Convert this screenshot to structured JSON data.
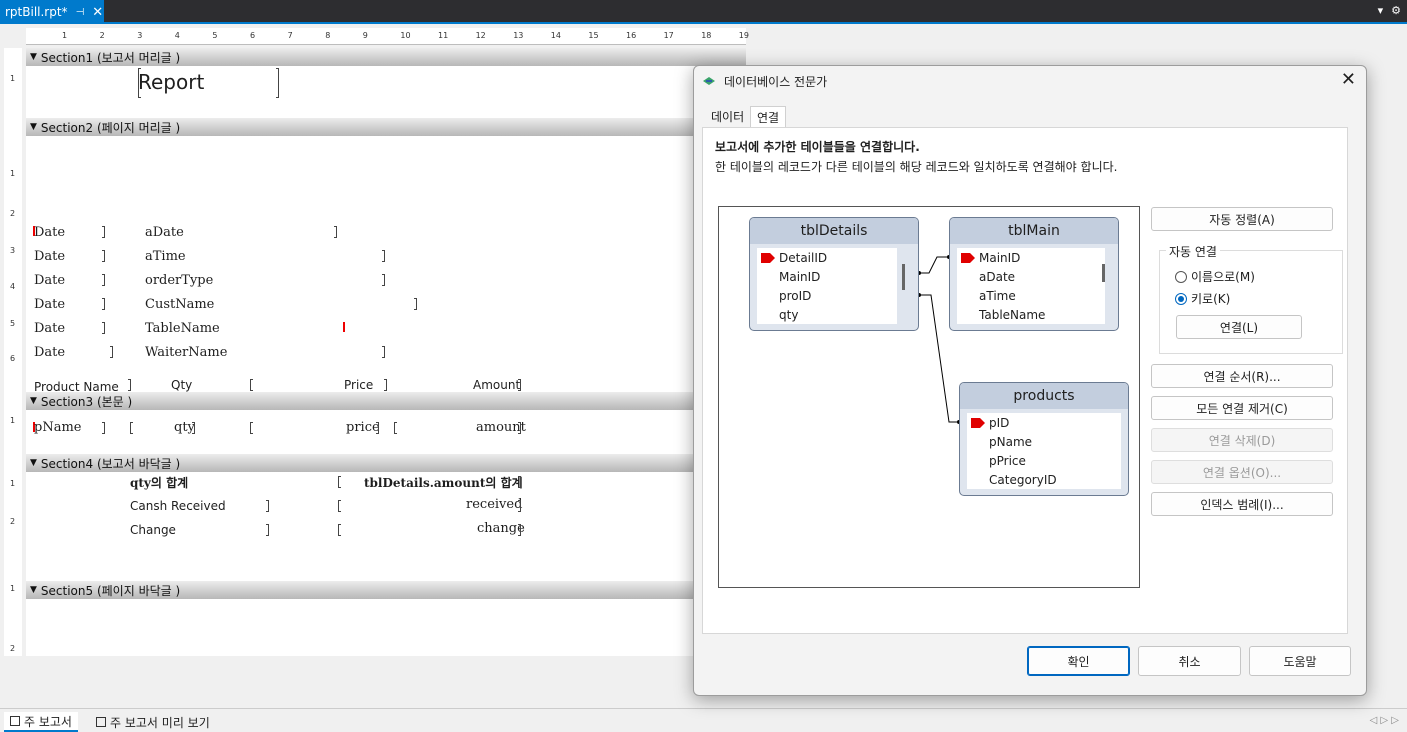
{
  "tab": {
    "title": "rptBill.rpt*",
    "pin": "⊣",
    "close": "✕"
  },
  "ruler_numbers": [
    "1",
    "2",
    "3",
    "4",
    "5",
    "6",
    "7",
    "8",
    "9",
    "10",
    "11",
    "12",
    "13",
    "14",
    "15",
    "16",
    "17",
    "18",
    "19"
  ],
  "left_ruler_numbers": [
    "1",
    "1",
    "2",
    "3",
    "4",
    "5",
    "6",
    "1",
    "1",
    "2",
    "1",
    "2"
  ],
  "sections": {
    "s1": "Section1 (보고서 머리글 )",
    "s2": "Section2 (페이지 머리글 )",
    "s3": "Section3 (본문 )",
    "s4": "Section4 (보고서 바닥글 )",
    "s5": "Section5 (페이지 바닥글 )"
  },
  "report": {
    "title": "Report",
    "header_labels": [
      "Date",
      "Date",
      "Date",
      "Date",
      "Date",
      "Date"
    ],
    "header_fields": [
      "aDate",
      "aTime",
      "orderType",
      "CustName",
      "TableName",
      "WaiterName"
    ],
    "columns": {
      "product": "Product Name",
      "qty": "Qty",
      "price": "Price",
      "amount": "Amount"
    },
    "detail": {
      "pname": "pName",
      "qty": "qty",
      "price": "price",
      "amount": "amount"
    },
    "footer": {
      "qty_sum": "qty의 합계",
      "amount_sum": "tblDetails.amount의 합계",
      "cash_label": "Cansh Received",
      "cash_field": "received",
      "change_label": "Change",
      "change_field": "change"
    }
  },
  "bottom_tabs": {
    "main": "주 보고서",
    "preview": "주 보고서 미리 보기"
  },
  "dialog": {
    "title": "데이터베이스 전문가",
    "tabs": {
      "data": "데이터",
      "links": "연결"
    },
    "heading": "보고서에 추가한 테이블들을 연결합니다.",
    "subheading": "한 테이블의 레코드가 다른 테이블의 해당 레코드와 일치하도록 연결해야 합니다.",
    "tables": {
      "details": {
        "name": "tblDetails",
        "fields": [
          "DetailID",
          "MainID",
          "proID",
          "qty"
        ]
      },
      "main": {
        "name": "tblMain",
        "fields": [
          "MainID",
          "aDate",
          "aTime",
          "TableName"
        ]
      },
      "products": {
        "name": "products",
        "fields": [
          "pID",
          "pName",
          "pPrice",
          "CategoryID"
        ]
      }
    },
    "buttons": {
      "auto_arrange": "자동 정렬(A)",
      "auto_link_group": "자동 연결",
      "by_name": "이름으로(M)",
      "by_key": "키로(K)",
      "link": "연결(L)",
      "link_order": "연결 순서(R)...",
      "clear_links": "모든 연결 제거(C)",
      "delete_link": "연결 삭제(D)",
      "link_options": "연결 옵션(O)...",
      "index_legend": "인덱스 범례(I)...",
      "ok": "확인",
      "cancel": "취소",
      "help": "도움말"
    }
  },
  "colors": {
    "accent": "#007acc",
    "key_icon": "#e00000",
    "table_header": "#c3cede"
  }
}
